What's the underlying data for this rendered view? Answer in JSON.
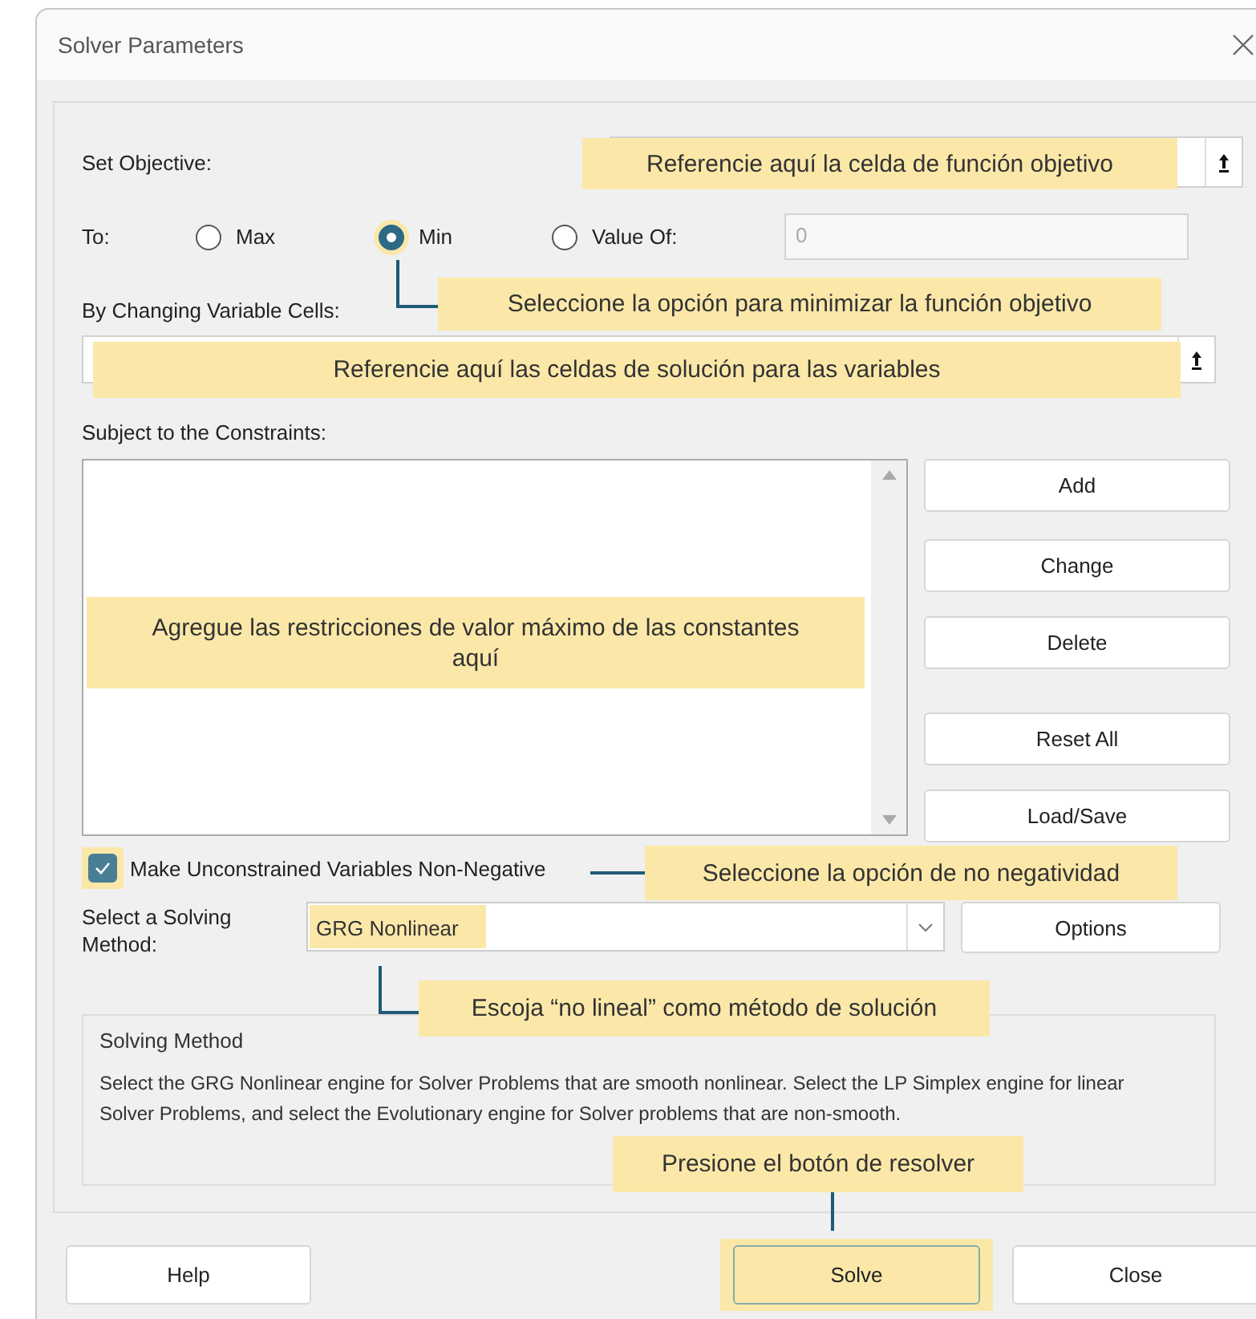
{
  "window": {
    "title": "Solver Parameters"
  },
  "objective": {
    "label": "Set Objective:"
  },
  "to": {
    "label": "To:",
    "value_of": "0",
    "options": [
      {
        "label": "Max",
        "selected": false,
        "highlighted": false
      },
      {
        "label": "Min",
        "selected": true,
        "highlighted": true
      },
      {
        "label": "Value Of:",
        "selected": false,
        "highlighted": false
      }
    ]
  },
  "variable_cells": {
    "label": "By Changing Variable Cells:"
  },
  "constraints": {
    "label": "Subject to the Constraints:",
    "buttons": [
      "Add",
      "Change",
      "Delete",
      "Reset All",
      "Load/Save"
    ]
  },
  "non_negative": {
    "label": "Make Unconstrained Variables Non-Negative",
    "checked": true,
    "highlighted": true
  },
  "method": {
    "label": "Select a Solving Method:",
    "value": "GRG Nonlinear",
    "highlighted": true,
    "options_button": "Options"
  },
  "solving_method": {
    "title": "Solving Method",
    "description": "Select the GRG Nonlinear engine for Solver Problems that are smooth nonlinear. Select the LP Simplex engine for linear Solver Problems, and select the Evolutionary engine for Solver problems that are non-smooth."
  },
  "footer_buttons": [
    {
      "label": "Help",
      "highlighted": false
    },
    {
      "label": "Solve",
      "highlighted": true
    },
    {
      "label": "Close",
      "highlighted": false
    }
  ],
  "callouts": [
    {
      "text": "Referencie aquí la celda de función objetivo"
    },
    {
      "text": "Seleccione la opción para minimizar la función objetivo"
    },
    {
      "text": "Referencie aquí las celdas de solución para las variables"
    },
    {
      "text": "Agregue las restricciones de valor máximo de las constantes aquí"
    },
    {
      "text": "Seleccione la opción de no negatividad"
    },
    {
      "text": "Escoja “no lineal” como método de solución"
    },
    {
      "text": "Presione el botón de resolver"
    }
  ]
}
